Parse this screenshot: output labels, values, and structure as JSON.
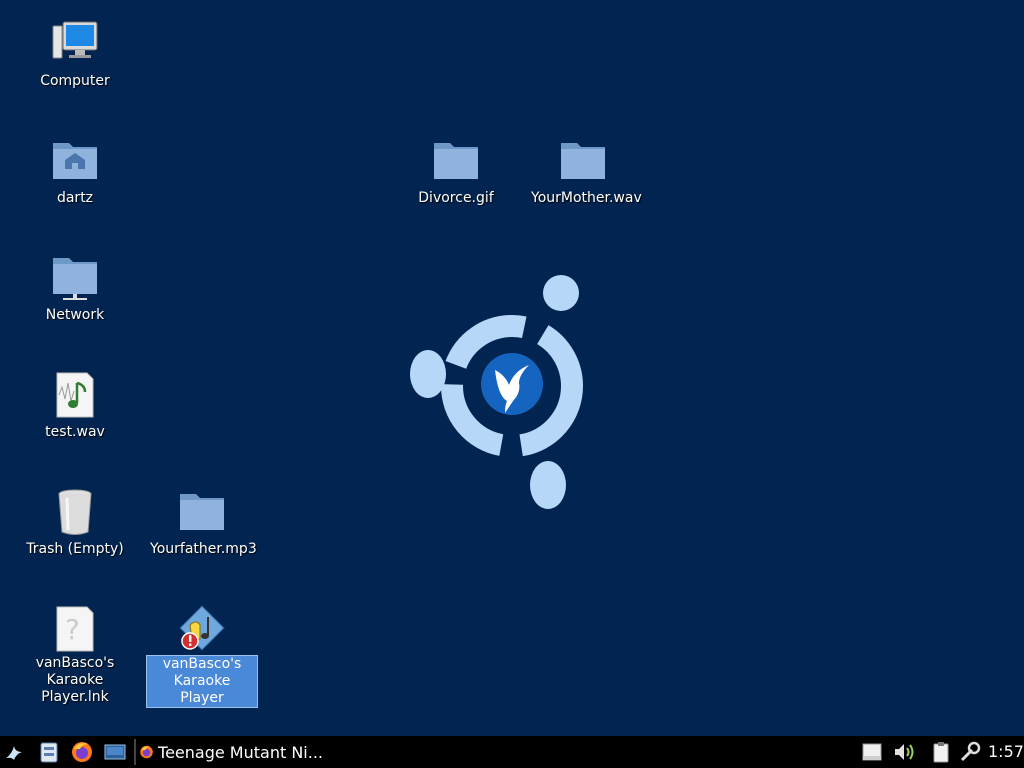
{
  "desktop": {
    "icons": [
      {
        "label": "Computer",
        "icon": "computer-icon"
      },
      {
        "label": "dartz",
        "icon": "home-folder-icon"
      },
      {
        "label": "Network",
        "icon": "network-folder-icon"
      },
      {
        "label": "test.wav",
        "icon": "audio-file-icon"
      },
      {
        "label": "Trash (Empty)",
        "icon": "trash-icon"
      },
      {
        "label": "vanBasco's Karaoke Player.lnk",
        "icon": "unknown-file-icon"
      },
      {
        "label": "Divorce.gif",
        "icon": "folder-icon"
      },
      {
        "label": "YourMother.wav",
        "icon": "folder-icon"
      },
      {
        "label": "Yourfather.mp3",
        "icon": "folder-icon"
      },
      {
        "label": "vanBasco's Karaoke Player",
        "icon": "karaoke-player-icon",
        "selected": true
      }
    ],
    "wallpaper": "hummingbird-logo"
  },
  "taskbar": {
    "launchers": [
      "start-menu-icon",
      "file-manager-icon",
      "firefox-icon",
      "desktop-icon"
    ],
    "task": {
      "label": "Teenage Mutant Ni...",
      "icon": "firefox-icon"
    },
    "tray": [
      "removable-drive-icon",
      "volume-icon",
      "clipboard-icon",
      "network-icon"
    ],
    "clock": "1:57"
  },
  "colors": {
    "background": "#022450",
    "selection": "#4a88d8",
    "taskbar": "#000000"
  }
}
